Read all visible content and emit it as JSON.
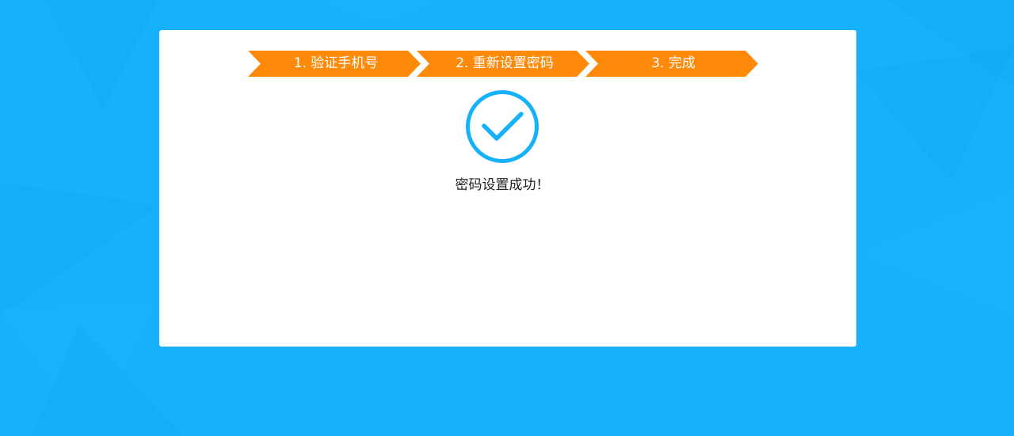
{
  "steps": [
    {
      "label": "1. 验证手机号"
    },
    {
      "label": "2. 重新设置密码"
    },
    {
      "label": "3. 完成"
    }
  ],
  "result": {
    "icon": "check-circle-icon",
    "message": "密码设置成功！"
  },
  "colors": {
    "background": "#15b1fb",
    "step": "#ff8a0a",
    "check": "#15b1fb"
  }
}
